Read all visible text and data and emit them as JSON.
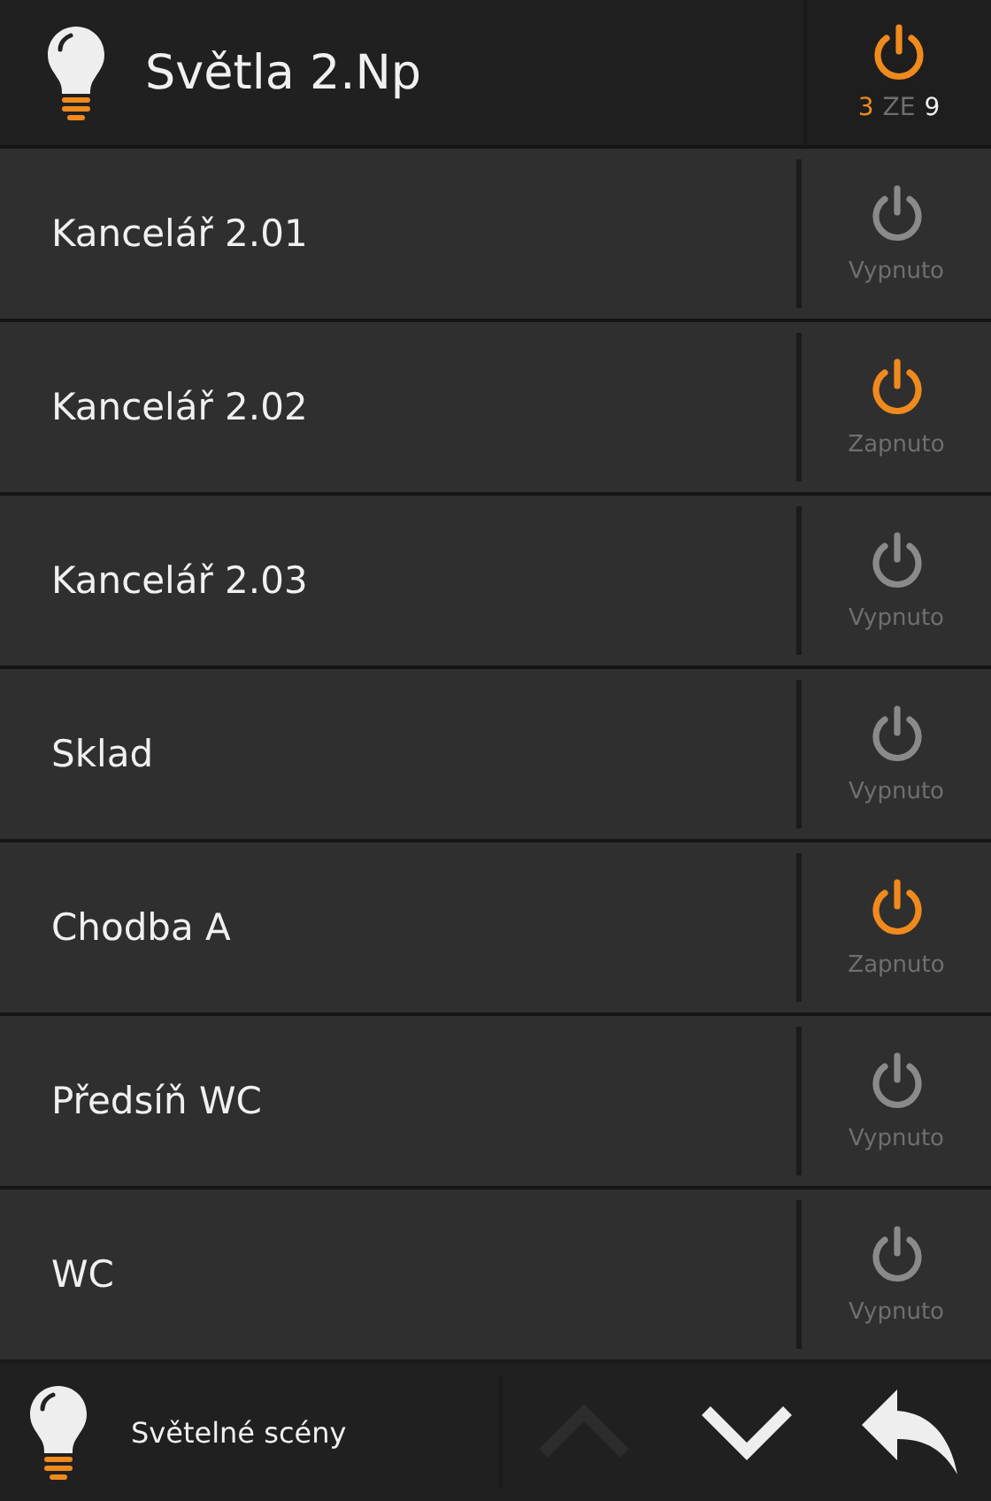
{
  "header": {
    "title": "Světla 2.Np",
    "on_count": "3",
    "of_label": "ZE",
    "total": "9",
    "on": true
  },
  "lights": [
    {
      "name": "Kancelář 2.01",
      "on": false,
      "status": "Vypnuto"
    },
    {
      "name": "Kancelář 2.02",
      "on": true,
      "status": "Zapnuto"
    },
    {
      "name": "Kancelář 2.03",
      "on": false,
      "status": "Vypnuto"
    },
    {
      "name": "Sklad",
      "on": false,
      "status": "Vypnuto"
    },
    {
      "name": "Chodba A",
      "on": true,
      "status": "Zapnuto"
    },
    {
      "name": "Předsíň WC",
      "on": false,
      "status": "Vypnuto"
    },
    {
      "name": "WC",
      "on": false,
      "status": "Vypnuto"
    }
  ],
  "footer": {
    "label": "Světelné scény",
    "up_disabled": true,
    "down_disabled": false
  }
}
